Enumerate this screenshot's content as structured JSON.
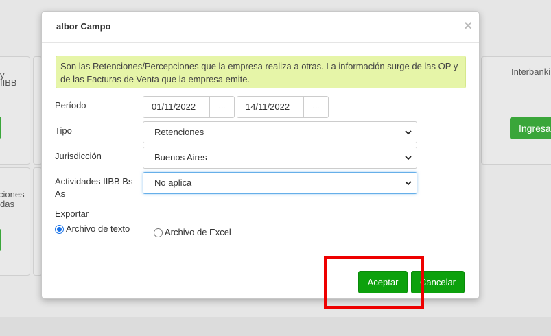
{
  "background": {
    "left_top_text_1": "y",
    "left_top_text_2": "IIBB",
    "left_bottom_text_1": "ciones",
    "left_bottom_text_2": "das",
    "right_top_text": "Interbanki",
    "right_button_label": "Ingresar"
  },
  "modal": {
    "title": "albor Campo",
    "close_glyph": "×",
    "info": "Son las Retenciones/Percepciones que la empresa realiza a otras. La información surge de las OP y de las Facturas de Venta que la empresa emite.",
    "periodo": {
      "label": "Período",
      "from": "01/11/2022",
      "to": "14/11/2022",
      "picker_label": "..."
    },
    "tipo": {
      "label": "Tipo",
      "value": "Retenciones"
    },
    "jurisdiccion": {
      "label": "Jurisdicción",
      "value": "Buenos Aires"
    },
    "actividades": {
      "label_line1": "Actividades IIBB Bs",
      "label_line2": "As",
      "value": "No aplica"
    },
    "exportar": {
      "label": "Exportar",
      "options": [
        {
          "label": "Archivo de texto",
          "checked": true
        },
        {
          "label": "Archivo de Excel",
          "checked": false
        }
      ]
    },
    "buttons": {
      "accept": "Aceptar",
      "cancel": "Cancelar"
    }
  },
  "colors": {
    "accent_green": "#0da10d",
    "info_bg": "#e6f5a8",
    "highlight_red": "#ee0000",
    "focus_blue": "#66afe9"
  },
  "icons": {
    "close": "close-icon",
    "chevron": "chevron-down-icon",
    "date_picker": "ellipsis-icon"
  }
}
